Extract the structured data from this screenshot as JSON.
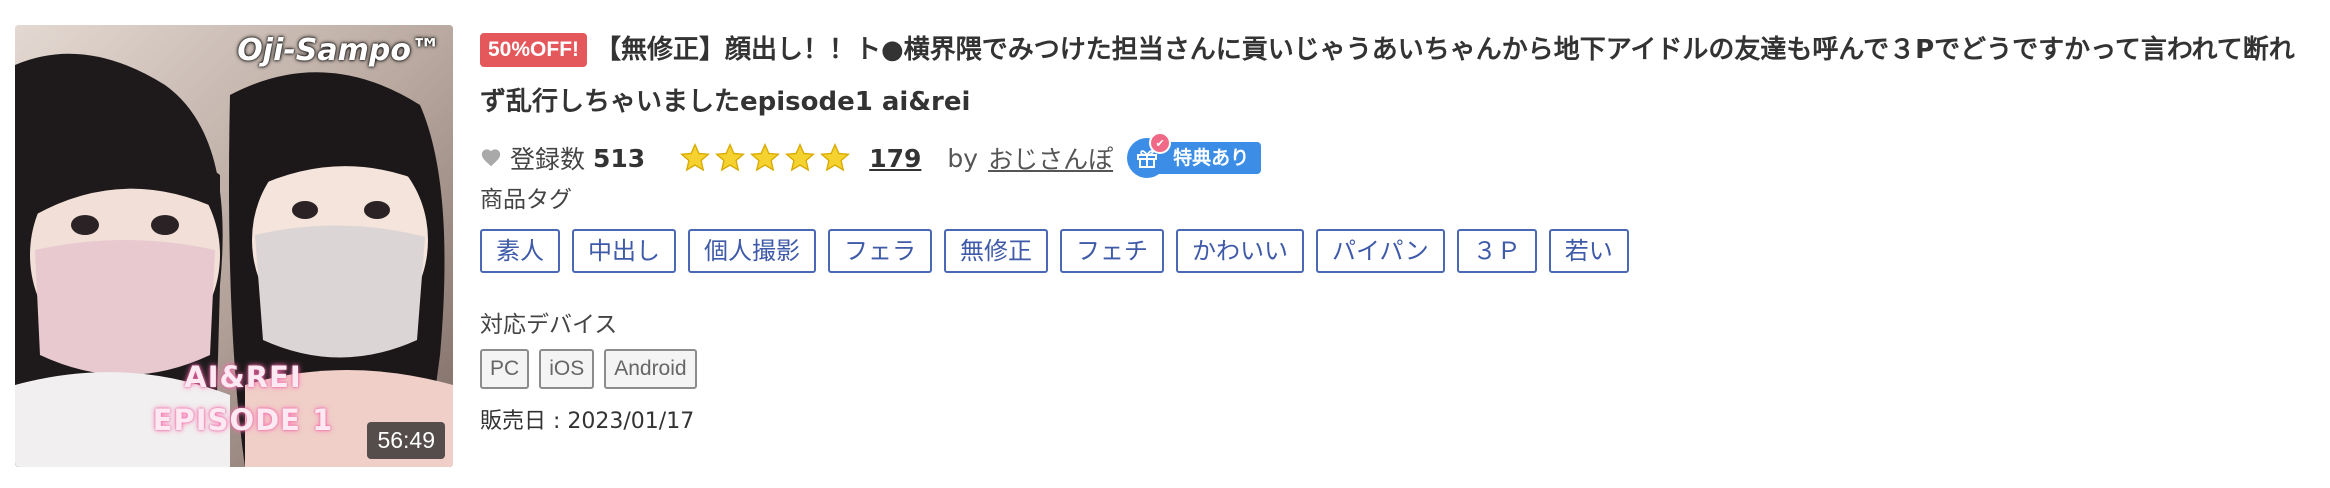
{
  "thumbnail": {
    "brand": "Oji-Sampo™",
    "overlay_line1": "AI&REI",
    "overlay_line2": "EPISODE 1",
    "duration": "56:49"
  },
  "product": {
    "discount_badge": "50%OFF!",
    "title": "【無修正】顔出し！！ト●横界隈でみつけた担当さんに貢いじゃうあいちゃんから地下アイドルの友達も呼んで３Pでどうですかって言われて断れず乱行しちゃいましたepisode1 ai&rei"
  },
  "meta": {
    "heart_icon": "heart-icon",
    "favorites_label": "登録数",
    "favorites_count": "513",
    "rating": 5,
    "review_count": "179",
    "by_label": "by",
    "author": "おじさんぽ",
    "gift_icon": "gift-icon",
    "tokuten_label": "特典あり"
  },
  "tags_section": {
    "label": "商品タグ",
    "tags": [
      "素人",
      "中出し",
      "個人撮影",
      "フェラ",
      "無修正",
      "フェチ",
      "かわいい",
      "パイパン",
      "３Ｐ",
      "若い"
    ]
  },
  "devices_section": {
    "label": "対応デバイス",
    "devices": [
      "PC",
      "iOS",
      "Android"
    ]
  },
  "release": {
    "text": "販売日 : 2023/01/17"
  },
  "colors": {
    "discount_bg": "#e4575b",
    "tag_border": "#4a68b4",
    "tokuten_bg": "#3b8de6",
    "star": "#f2c12e"
  }
}
